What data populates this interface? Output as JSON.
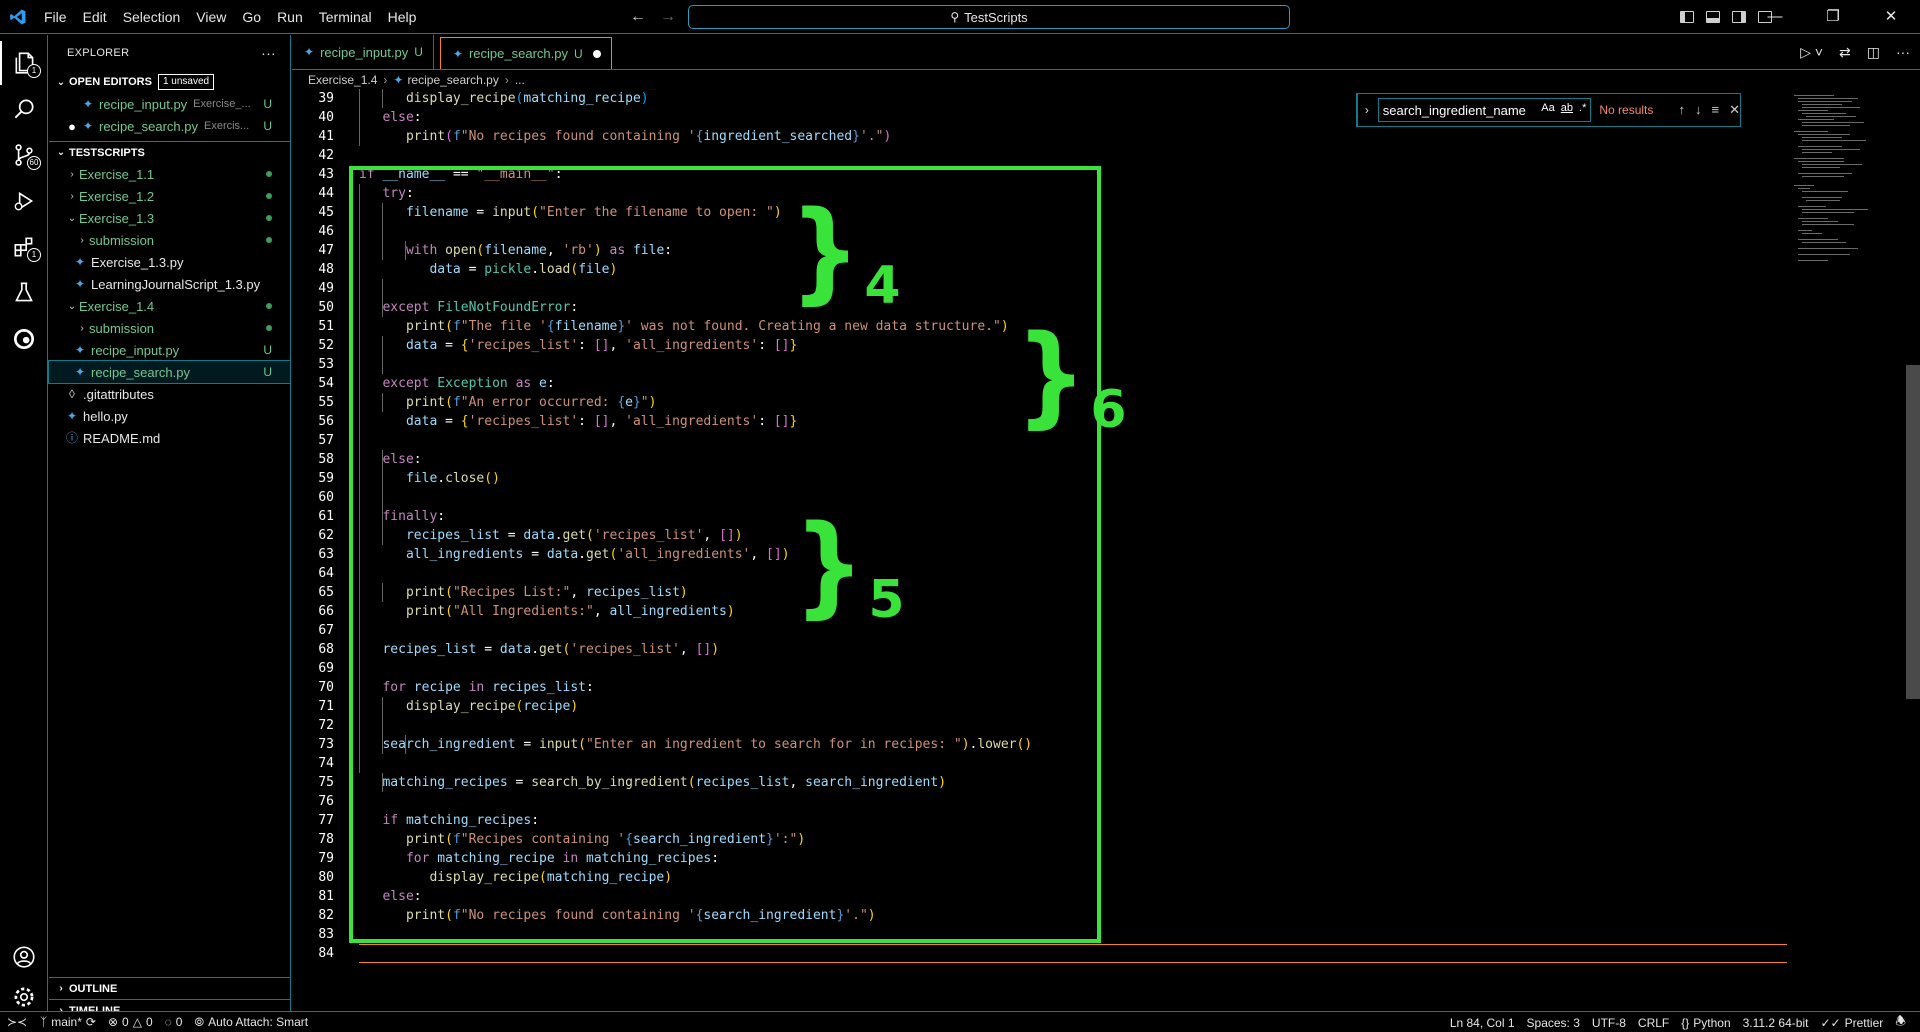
{
  "window": {
    "search_text": "TestScripts",
    "menu": [
      "File",
      "Edit",
      "Selection",
      "View",
      "Go",
      "Run",
      "Terminal",
      "Help"
    ]
  },
  "activity": {
    "scm_badge": "60",
    "extensions_badge": "1",
    "explorer_badge": "1"
  },
  "sidebar": {
    "title": "EXPLORER",
    "open_editors": {
      "label": "OPEN EDITORS",
      "unsaved": "1 unsaved",
      "items": [
        {
          "name": "recipe_input.py",
          "desc": "Exercise_...",
          "status": "U"
        },
        {
          "name": "recipe_search.py",
          "desc": "Exercis...",
          "status": "U"
        }
      ]
    },
    "workspace": {
      "label": "TESTSCRIPTS",
      "items": [
        {
          "name": "Exercise_1.1"
        },
        {
          "name": "Exercise_1.2"
        },
        {
          "name": "Exercise_1.3"
        },
        {
          "name": "submission"
        },
        {
          "name": "Exercise_1.3.py"
        },
        {
          "name": "LearningJournalScript_1.3.py"
        },
        {
          "name": "Exercise_1.4"
        },
        {
          "name": "submission"
        },
        {
          "name": "recipe_input.py",
          "status": "U"
        },
        {
          "name": "recipe_search.py",
          "status": "U"
        },
        {
          "name": ".gitattributes"
        },
        {
          "name": "hello.py"
        },
        {
          "name": "README.md"
        }
      ]
    },
    "outline": "OUTLINE",
    "timeline": "TIMELINE"
  },
  "tabs": [
    {
      "name": "recipe_input.py",
      "status": "U"
    },
    {
      "name": "recipe_search.py",
      "status": "U"
    }
  ],
  "breadcrumb": {
    "folder": "Exercise_1.4",
    "file": "recipe_search.py",
    "more": "..."
  },
  "find": {
    "query": "search_ingredient_name",
    "opt_case": "Aa",
    "opt_word": "ab",
    "opt_regex": ".*",
    "result": "No results"
  },
  "annotations": {
    "a": "4",
    "b": "6",
    "c": "5"
  },
  "status": {
    "branch": "main*",
    "errors": "0",
    "warnings": "0",
    "ports": "0",
    "auto_attach": "Auto Attach: Smart",
    "position": "Ln 84, Col 1",
    "spaces": "Spaces: 3",
    "encoding": "UTF-8",
    "eol": "CRLF",
    "language": "Python",
    "interpreter": "3.11.2 64-bit",
    "formatter": "Prettier"
  }
}
